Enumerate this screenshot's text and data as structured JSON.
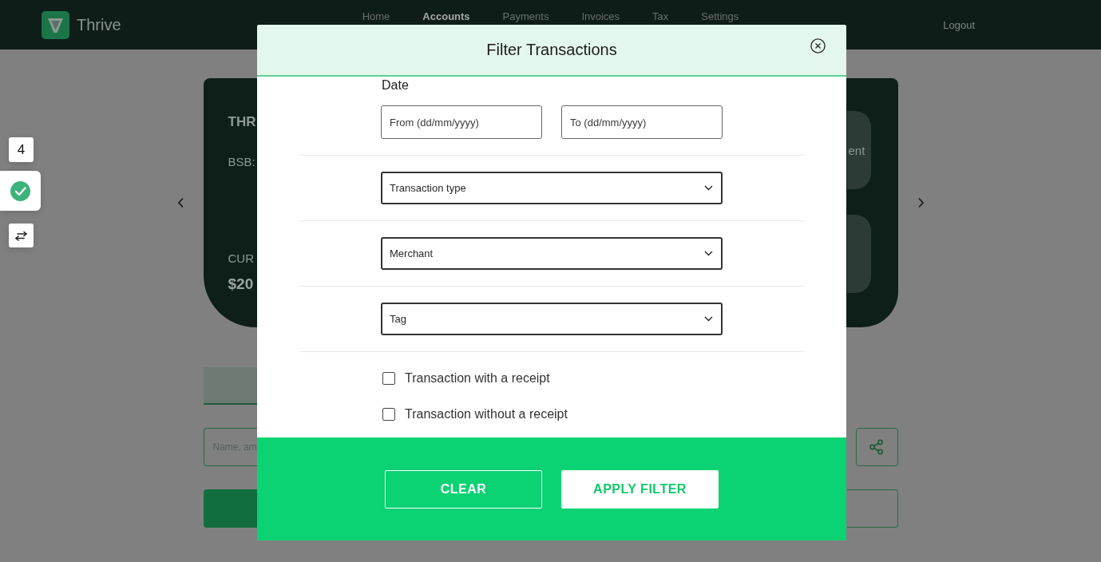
{
  "header": {
    "brand": "Thrive",
    "nav": [
      {
        "label": "Home",
        "selected": false
      },
      {
        "label": "Accounts",
        "selected": true
      },
      {
        "label": "Payments",
        "selected": false
      },
      {
        "label": "Invoices",
        "selected": false
      },
      {
        "label": "Tax",
        "selected": false
      },
      {
        "label": "Settings",
        "selected": false
      }
    ],
    "logout": "Logout"
  },
  "side_widget": {
    "count": "4"
  },
  "account_card": {
    "name": "THR",
    "bsb": "BSB:",
    "balance_label": "CUR",
    "balance": "$20",
    "tiles": [
      {
        "kind": "labeled",
        "label": "ent"
      },
      {
        "kind": "blank"
      }
    ]
  },
  "search": {
    "placeholder": "Name, am"
  },
  "modal": {
    "title": "Filter Transactions",
    "date": {
      "label": "Date",
      "from": {
        "placeholder": "From (dd/mm/yyyy)"
      },
      "to": {
        "placeholder": "To (dd/mm/yyyy)"
      }
    },
    "selects": [
      {
        "placeholder": "Transaction type"
      },
      {
        "placeholder": "Merchant"
      },
      {
        "placeholder": "Tag"
      }
    ],
    "checkboxes": [
      {
        "label": "Transaction with a receipt",
        "checked": false
      },
      {
        "label": "Transaction without a receipt",
        "checked": false
      }
    ],
    "buttons": [
      {
        "label": "CLEAR",
        "kind": "outline"
      },
      {
        "label": "APPLY FILTER",
        "kind": "solid"
      }
    ]
  }
}
